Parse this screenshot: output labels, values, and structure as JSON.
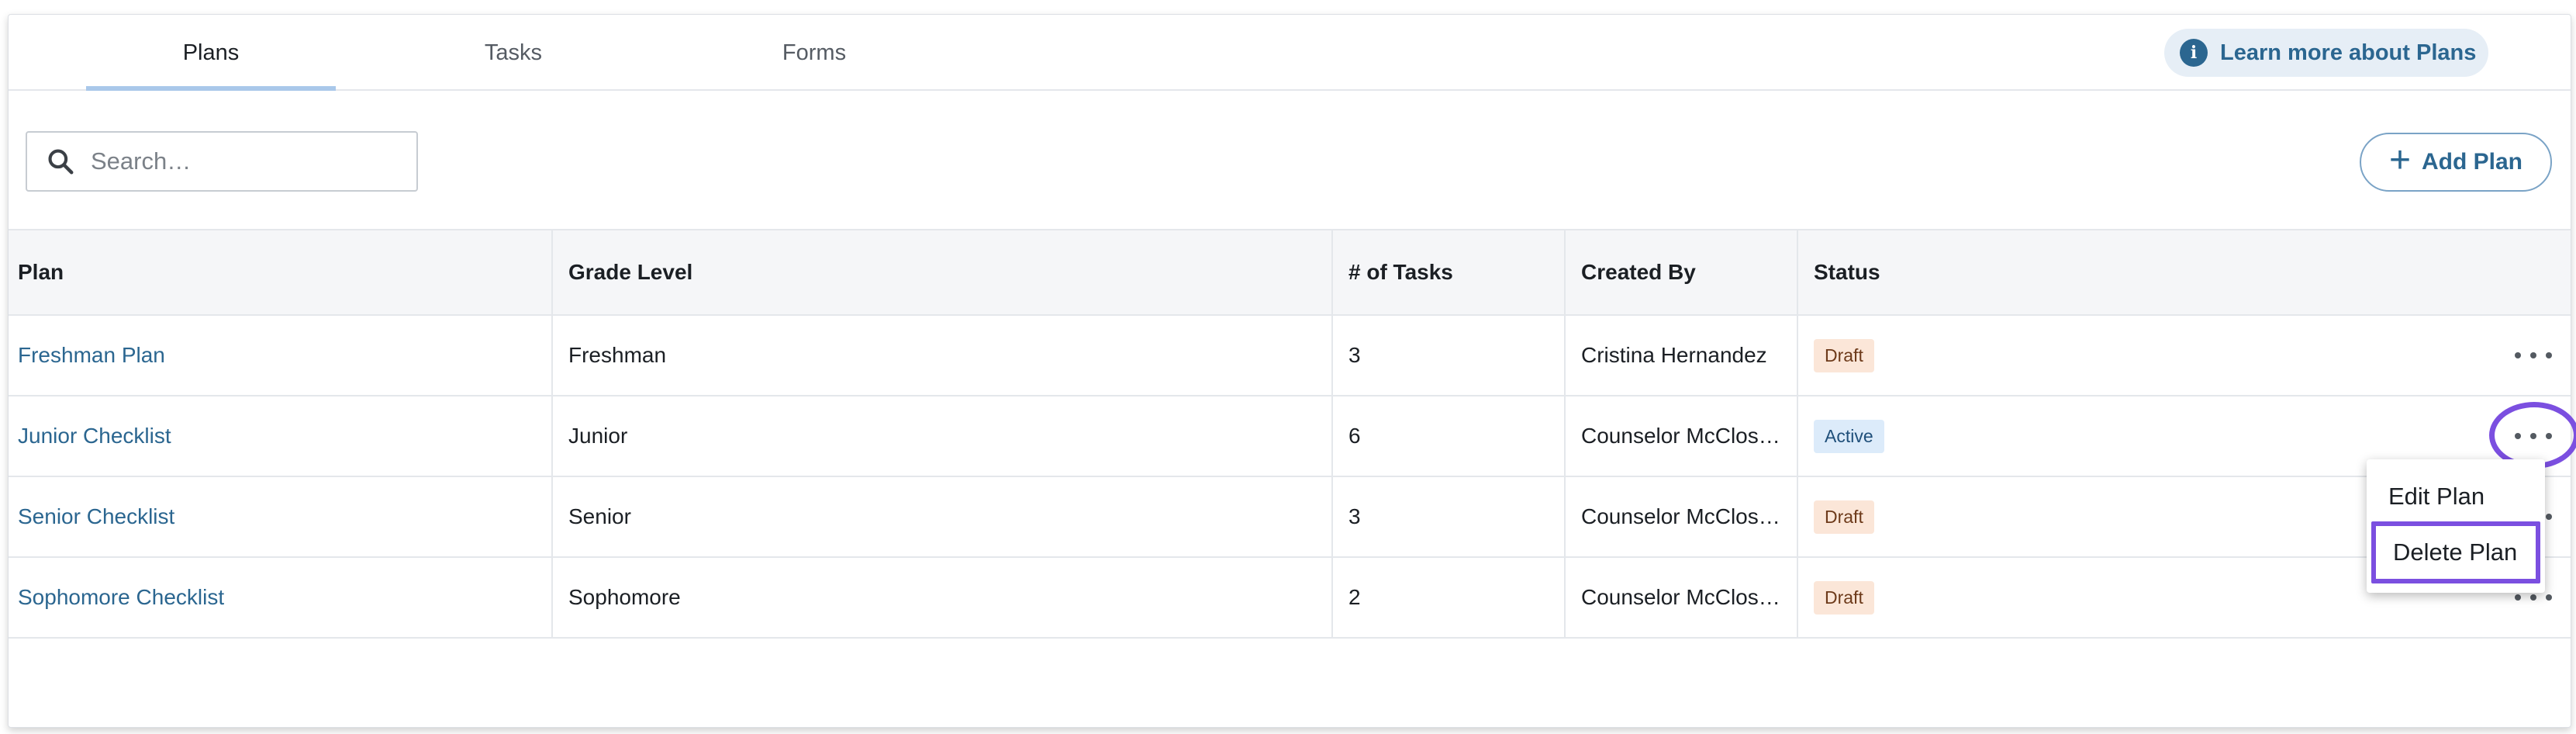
{
  "tabs": [
    {
      "label": "Plans",
      "active": true
    },
    {
      "label": "Tasks",
      "active": false
    },
    {
      "label": "Forms",
      "active": false
    }
  ],
  "learn_more": {
    "label": "Learn more about Plans",
    "icon": "info-icon"
  },
  "search": {
    "placeholder": "Search…",
    "value": "",
    "icon": "search-icon"
  },
  "add_plan": {
    "label": "Add Plan",
    "icon": "plus-icon"
  },
  "table": {
    "headers": [
      "Plan",
      "Grade Level",
      "# of Tasks",
      "Created By",
      "Status"
    ],
    "rows": [
      {
        "plan": "Freshman Plan",
        "grade": "Freshman",
        "tasks": "3",
        "created_by": "Cristina Hernandez",
        "status": "Draft"
      },
      {
        "plan": "Junior Checklist",
        "grade": "Junior",
        "tasks": "6",
        "created_by": "Counselor McClos…",
        "status": "Active"
      },
      {
        "plan": "Senior Checklist",
        "grade": "Senior",
        "tasks": "3",
        "created_by": "Counselor McClos…",
        "status": "Draft"
      },
      {
        "plan": "Sophomore Checklist",
        "grade": "Sophomore",
        "tasks": "2",
        "created_by": "Counselor McClos…",
        "status": "Draft"
      }
    ]
  },
  "row_menu": {
    "items": [
      {
        "label": "Edit Plan"
      },
      {
        "label": "Delete Plan",
        "highlighted": true
      }
    ]
  },
  "colors": {
    "accent": "#2b6690",
    "highlight": "#7b4fe0",
    "draft_bg": "#fbe6d8",
    "active_bg": "#dcebfa"
  }
}
